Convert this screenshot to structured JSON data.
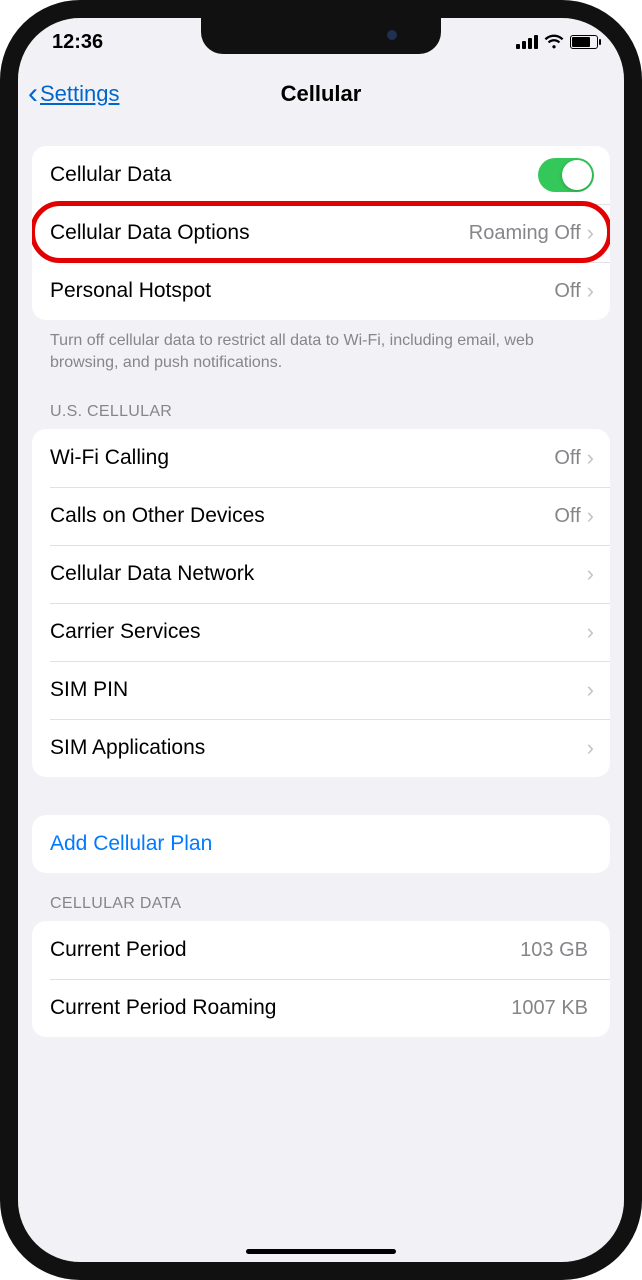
{
  "status": {
    "time": "12:36"
  },
  "nav": {
    "back_label": "Settings",
    "title": "Cellular"
  },
  "group1": {
    "cellular_data_label": "Cellular Data",
    "options_label": "Cellular Data Options",
    "options_value": "Roaming Off",
    "hotspot_label": "Personal Hotspot",
    "hotspot_value": "Off",
    "footer": "Turn off cellular data to restrict all data to Wi-Fi, including email, web browsing, and push notifications."
  },
  "carrier_section": {
    "header": "U.S. CELLULAR",
    "rows": [
      {
        "label": "Wi-Fi Calling",
        "value": "Off"
      },
      {
        "label": "Calls on Other Devices",
        "value": "Off"
      },
      {
        "label": "Cellular Data Network",
        "value": ""
      },
      {
        "label": "Carrier Services",
        "value": ""
      },
      {
        "label": "SIM PIN",
        "value": ""
      },
      {
        "label": "SIM Applications",
        "value": ""
      }
    ]
  },
  "add_plan": {
    "label": "Add Cellular Plan"
  },
  "usage_section": {
    "header": "CELLULAR DATA",
    "rows": [
      {
        "label": "Current Period",
        "value": "103 GB"
      },
      {
        "label": "Current Period Roaming",
        "value": "1007 KB"
      }
    ]
  }
}
